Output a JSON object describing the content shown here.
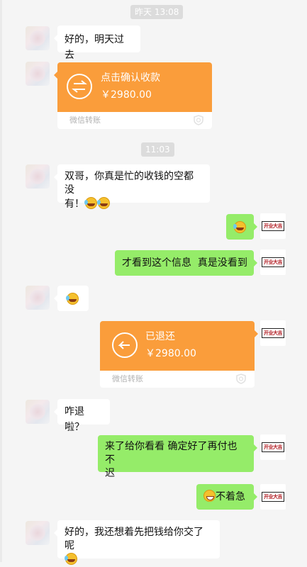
{
  "timestamps": {
    "t1": "昨天 13:08",
    "t2": "11:03"
  },
  "messages": {
    "m1": {
      "sender": "contact",
      "text": "好的，明天过去"
    },
    "m2": {
      "sender": "contact",
      "type": "transfer",
      "icon": "transfer-arrows-icon",
      "title": "点击确认收款",
      "amount": "￥2980.00",
      "footer": "微信转账"
    },
    "m3": {
      "sender": "contact",
      "text_line1": "双哥，你真是忙的收钱的空都没",
      "text_line2": "有！",
      "emojis": [
        "laugh-cry-emoji",
        "laugh-cry-emoji"
      ]
    },
    "m4": {
      "sender": "me",
      "emojis": [
        "laugh-cry-emoji"
      ]
    },
    "m5": {
      "sender": "me",
      "text": "才看到这个信息  真是没看到"
    },
    "m6": {
      "sender": "contact",
      "emojis": [
        "laugh-cry-emoji"
      ]
    },
    "m7": {
      "sender": "me",
      "type": "transfer",
      "icon": "return-arrow-icon",
      "title": "已退还",
      "amount": "￥2980.00",
      "footer": "微信转账"
    },
    "m8": {
      "sender": "contact",
      "text": "咋退啦？"
    },
    "m9": {
      "sender": "me",
      "text_line1": "来了给你看看 确定好了再付也不",
      "text_line2": "迟"
    },
    "m10": {
      "sender": "me",
      "text": "不着急",
      "emojis": [
        "grin-emoji"
      ]
    },
    "m11": {
      "sender": "contact",
      "text_line1": "好的，我还想着先把钱给你交了呢",
      "emojis": [
        "laugh-cry-emoji"
      ]
    }
  },
  "colors": {
    "background": "#f5f5f5",
    "incoming_bubble": "#ffffff",
    "outgoing_bubble": "#95ec69",
    "transfer_card": "#fa9d3b",
    "timestamp_bg": "#dcdcdc"
  },
  "avatars": {
    "contact": "blurred-contact-avatar",
    "me": "red-logo-avatar",
    "me_logo_text": "开业大吉"
  }
}
